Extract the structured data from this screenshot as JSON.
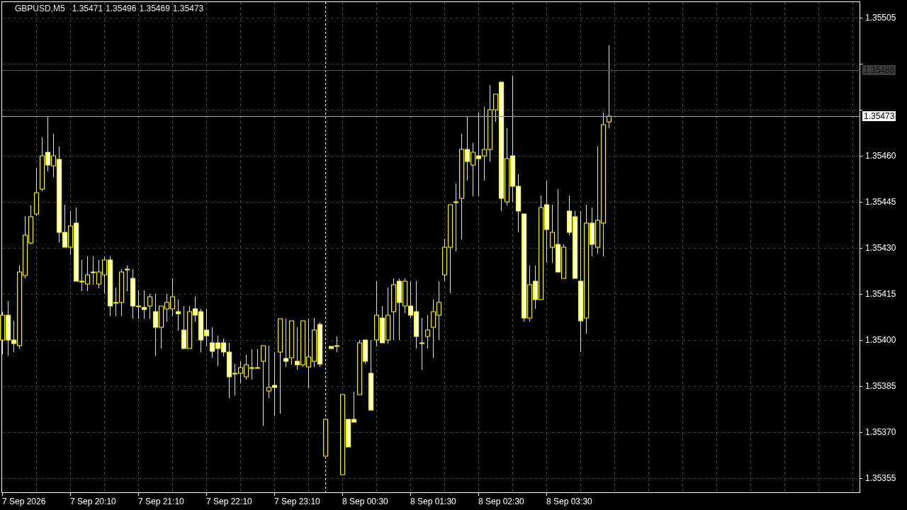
{
  "chart_header": {
    "symbol": "GBPUSD,M5",
    "quotes": [
      "1.35471",
      "1.35496",
      "1.35469",
      "1.35473"
    ]
  },
  "price_axis": [
    "1.35505",
    "1.35460",
    "1.35445",
    "1.35430",
    "1.35415",
    "1.35400",
    "1.35385",
    "1.35370",
    "1.35355"
  ],
  "price_lines": [
    {
      "kind": "ask",
      "label": "1.35488"
    },
    {
      "kind": "bid",
      "label": "1.35473"
    }
  ],
  "time_axis": [
    "7 Sep 2026",
    "7 Sep 20:10",
    "7 Sep 21:10",
    "7 Sep 22:10",
    "7 Sep 23:10",
    "8 Sep 00:30",
    "8 Sep 01:30",
    "8 Sep 02:30",
    "8 Sep 03:30"
  ]
}
